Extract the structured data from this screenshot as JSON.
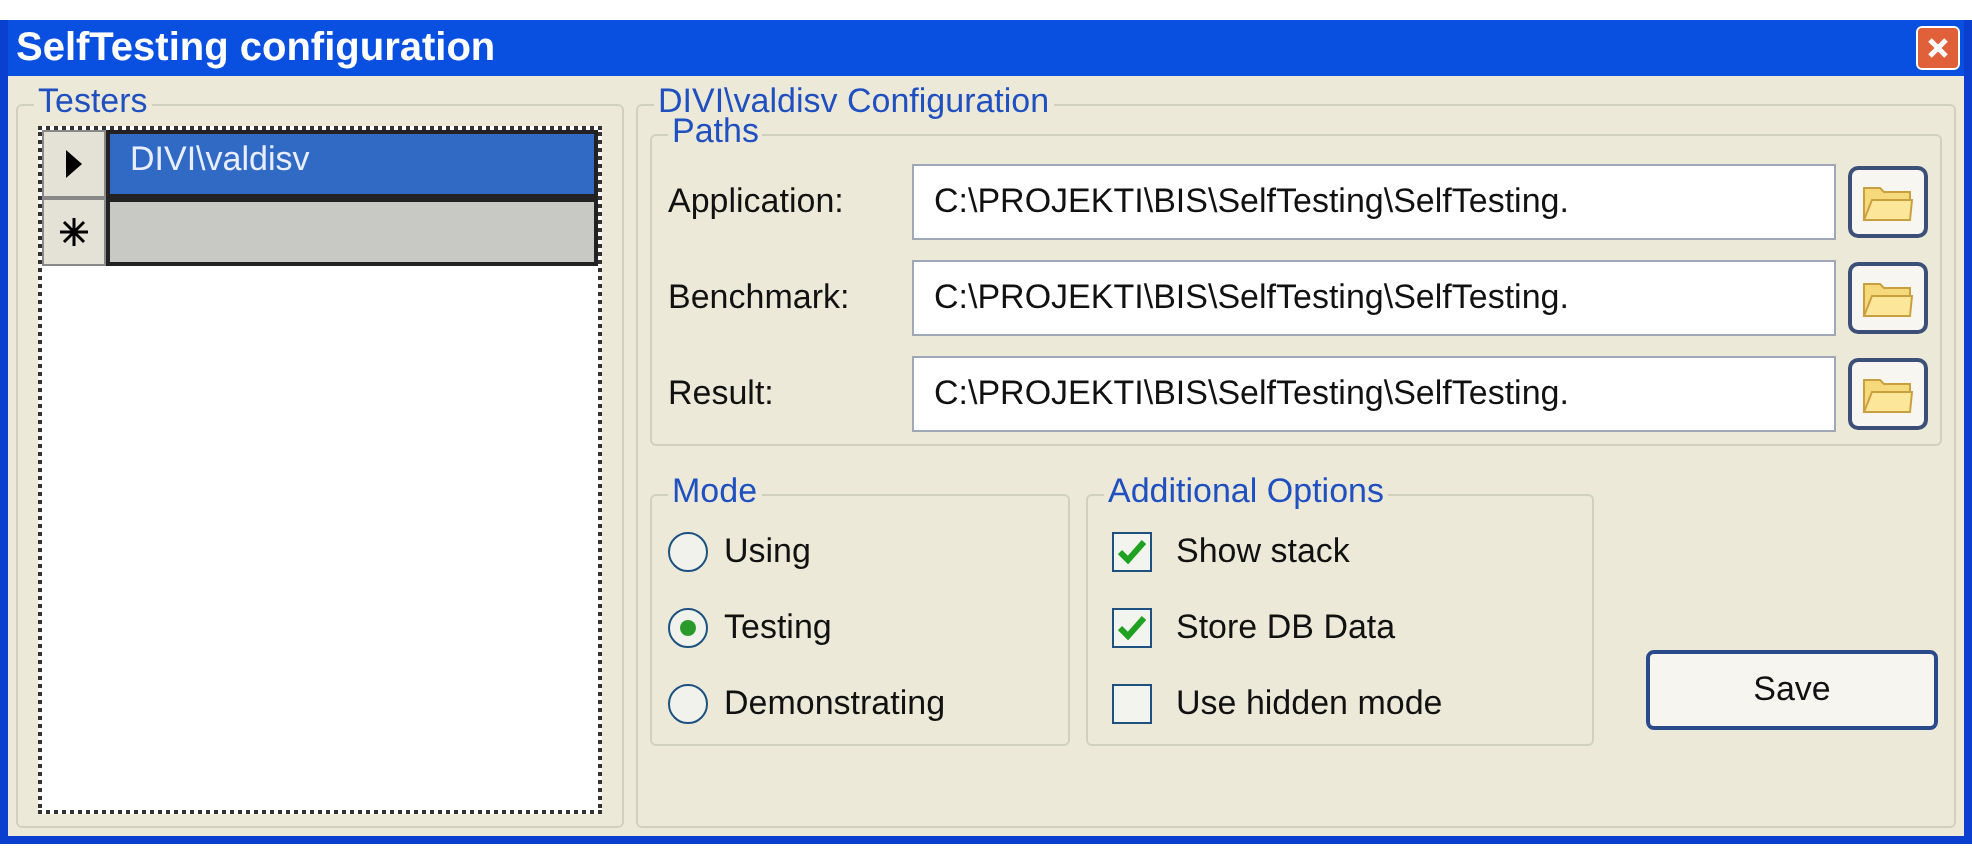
{
  "window": {
    "title": "SelfTesting configuration"
  },
  "testers": {
    "title": "Testers",
    "rows": [
      {
        "kind": "record",
        "name": "DIVI\\valdisv",
        "selected": true
      },
      {
        "kind": "new",
        "name": "",
        "selected": false
      }
    ]
  },
  "configuration": {
    "title": "DIVI\\valdisv Configuration",
    "paths": {
      "title": "Paths",
      "rows": [
        {
          "label": "Application:",
          "value": "C:\\PROJEKTI\\BIS\\SelfTesting\\SelfTesting."
        },
        {
          "label": "Benchmark:",
          "value": "C:\\PROJEKTI\\BIS\\SelfTesting\\SelfTesting."
        },
        {
          "label": "Result:",
          "value": "C:\\PROJEKTI\\BIS\\SelfTesting\\SelfTesting."
        }
      ]
    },
    "mode": {
      "title": "Mode",
      "options": [
        {
          "label": "Using",
          "selected": false
        },
        {
          "label": "Testing",
          "selected": true
        },
        {
          "label": "Demonstrating",
          "selected": false
        }
      ]
    },
    "additional_options": {
      "title": "Additional Options",
      "options": [
        {
          "label": "Show stack",
          "checked": true
        },
        {
          "label": "Store DB Data",
          "checked": true
        },
        {
          "label": "Use hidden mode",
          "checked": false
        }
      ]
    },
    "save_button": "Save"
  }
}
